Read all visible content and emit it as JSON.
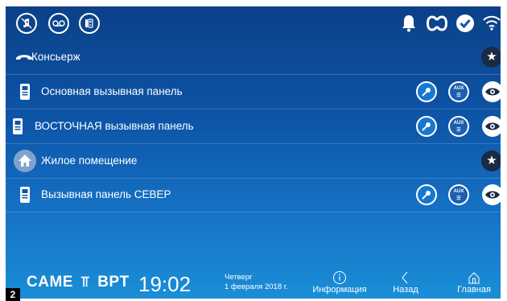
{
  "status_icons": {
    "left": [
      "music-mute-icon",
      "voicemail-icon",
      "intercom-icon"
    ],
    "right": [
      "bell-icon",
      "loop-icon",
      "check-icon",
      "wifi-icon"
    ]
  },
  "rows": [
    {
      "type": "concierge",
      "label": "Консьерж",
      "icon": "handset-icon",
      "actions": [
        "star-icon"
      ]
    },
    {
      "type": "panel",
      "label": "Основная вызывная панель",
      "icon": "door-panel-icon",
      "actions": [
        "key-icon",
        "aux-icon",
        "eye-icon"
      ]
    },
    {
      "type": "panel",
      "label": "ВОСТОЧНАЯ вызывная панель",
      "icon": "door-panel-icon",
      "actions": [
        "key-icon",
        "aux-icon",
        "eye-icon"
      ]
    },
    {
      "type": "home",
      "label": "Жилое помещение",
      "icon": "house-icon",
      "actions": [
        "star-icon"
      ]
    },
    {
      "type": "panel",
      "label": "Вызывная панель СЕВЕР",
      "icon": "door-panel-icon",
      "actions": [
        "key-icon",
        "aux-icon",
        "eye-icon"
      ]
    }
  ],
  "aux_label": "AUX",
  "footer": {
    "logo": "CAME",
    "logo_brand": "BPT",
    "time": "19:02",
    "weekday": "Четверг",
    "date": "1 февраля 2018 г.",
    "info_label": "Информация",
    "back_label": "Назад",
    "home_label": "Главная"
  },
  "page_number": "2"
}
